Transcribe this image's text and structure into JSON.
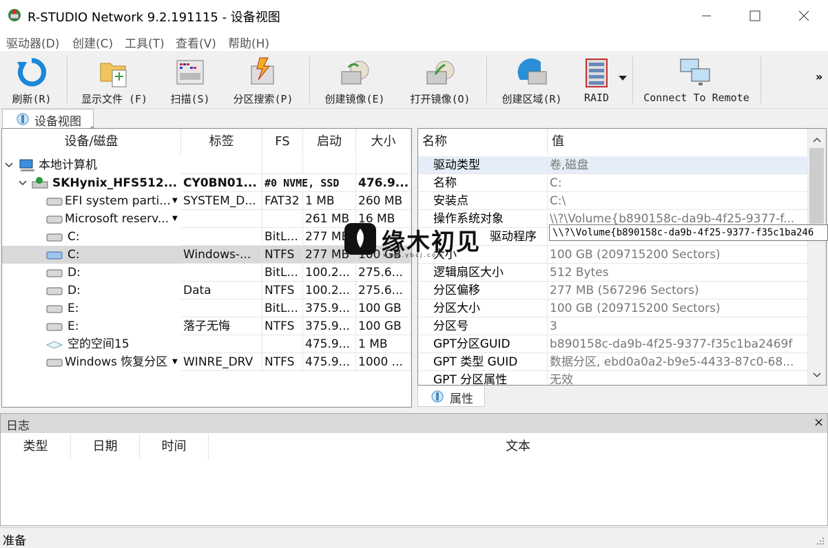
{
  "window": {
    "title": "R-STUDIO Network 9.2.191115 - 设备视图"
  },
  "menu": [
    "驱动器(D)",
    "创建(C)",
    "工具(T)",
    "查看(V)",
    "帮助(H)"
  ],
  "toolbar": {
    "refresh": "刷新(R)",
    "show_files": "显示文件 (F)",
    "scan": "扫描(S)",
    "partition_search": "分区搜索(P)",
    "create_image": "创建镜像(E)",
    "open_image": "打开镜像(O)",
    "create_region": "创建区域(R)",
    "raid": "RAID",
    "connect_remote": "Connect To Remote",
    "more": "»"
  },
  "tabs": {
    "device_view": "设备视图",
    "properties": "属性"
  },
  "device_table": {
    "columns": [
      "设备/磁盘",
      "标签",
      "FS",
      "启动",
      "大小"
    ],
    "rows": [
      {
        "name": "本地计算机",
        "label": "",
        "fs": "",
        "start": "",
        "size": ""
      },
      {
        "name": "SKHynix_HFS512...",
        "label": "CY0BN01...",
        "fs": "#0 NVME, SSD",
        "start": "",
        "size": "476.9..."
      },
      {
        "name": "EFI system parti...",
        "label": "SYSTEM_D...",
        "fs": "FAT32",
        "start": "1 MB",
        "size": "260 MB"
      },
      {
        "name": "Microsoft reserv...",
        "label": "",
        "fs": "",
        "start": "261 MB",
        "size": "16 MB"
      },
      {
        "name": "C:",
        "label": "",
        "fs": "BitL...",
        "start": "277 MB",
        "size": ""
      },
      {
        "name": "C:",
        "label": "Windows-...",
        "fs": "NTFS",
        "start": "277 MB",
        "size": "100 GB"
      },
      {
        "name": "D:",
        "label": "",
        "fs": "BitL...",
        "start": "100.2...",
        "size": "275.6..."
      },
      {
        "name": "D:",
        "label": "Data",
        "fs": "NTFS",
        "start": "100.2...",
        "size": "275.6..."
      },
      {
        "name": "E:",
        "label": "",
        "fs": "BitL...",
        "start": "375.9...",
        "size": "100 GB"
      },
      {
        "name": "E:",
        "label": "落子无悔",
        "fs": "NTFS",
        "start": "375.9...",
        "size": "100 GB"
      },
      {
        "name": "空的空间15",
        "label": "",
        "fs": "",
        "start": "475.9...",
        "size": "1 MB"
      },
      {
        "name": "Windows 恢复分区",
        "label": "WINRE_DRV",
        "fs": "NTFS",
        "start": "475.9...",
        "size": "1000 ..."
      }
    ]
  },
  "props_table": {
    "columns": [
      "名称",
      "值"
    ],
    "rows": [
      {
        "name": "驱动类型",
        "value": "卷,磁盘"
      },
      {
        "name": "名称",
        "value": "C:"
      },
      {
        "name": "安装点",
        "value": "C:\\"
      },
      {
        "name": "操作系统对象",
        "value": "\\\\?\\Volume{b890158c-da9b-4f25-9377-f..."
      },
      {
        "name": "驱动程序",
        "value": ""
      },
      {
        "name": "大小",
        "value": "100 GB (209715200 Sectors)"
      },
      {
        "name": "逻辑扇区大小",
        "value": "512 Bytes"
      },
      {
        "name": "分区偏移",
        "value": "277 MB (567296 Sectors)"
      },
      {
        "name": "分区大小",
        "value": "100 GB (209715200 Sectors)"
      },
      {
        "name": "分区号",
        "value": "3"
      },
      {
        "name": "GPT分区GUID",
        "value": "b890158c-da9b-4f25-9377-f35c1ba2469f"
      },
      {
        "name": "GPT 类型 GUID",
        "value": "数据分区, ebd0a0a2-b9e5-4433-87c0-68..."
      },
      {
        "name": "GPT 分区属性",
        "value": "无效"
      }
    ],
    "tooltip": "\\\\?\\Volume{b890158c-da9b-4f25-9377-f35c1ba246"
  },
  "log": {
    "title": "日志",
    "columns": [
      "类型",
      "日期",
      "时间",
      "文本"
    ],
    "close": "×"
  },
  "status": {
    "text": "准备"
  },
  "watermark": {
    "text": "缘木初见",
    "sub": "w w w . y b c j . c o m"
  }
}
